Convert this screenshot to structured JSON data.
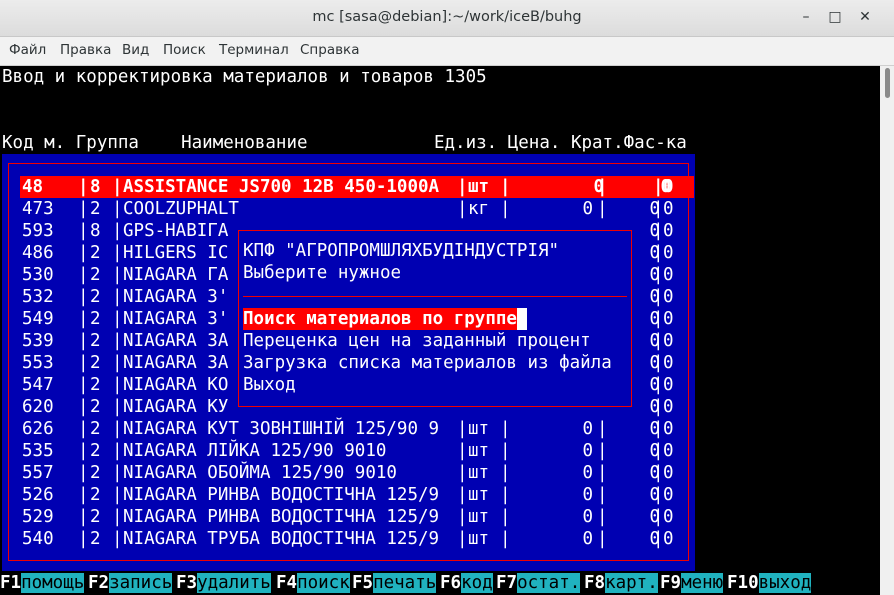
{
  "window": {
    "title": "mc [sasa@debian]:~/work/iceB/buhg",
    "min": "–",
    "max": "□",
    "close": "✕"
  },
  "menu": [
    "Файл",
    "Правка",
    "Вид",
    "Поиск",
    "Терминал",
    "Справка"
  ],
  "screen": {
    "heading": "Ввод и корректировка материалов и товаров 1305",
    "columns_header": "Код м. Группа    Наименование            Ед.из. Цена. Крат.Фас-ка"
  },
  "rows": [
    {
      "code": "48",
      "group": "8",
      "name": "ASSISTANCE JS700 12В 450-1000А",
      "unit": "шт",
      "price": "0",
      "krat": "0",
      "fas": "0",
      "selected": true
    },
    {
      "code": "473",
      "group": "2",
      "name": "COOLZUPHALT",
      "unit": "кг",
      "price": "0",
      "krat": "0",
      "fas": "0"
    },
    {
      "code": "593",
      "group": "8",
      "name": "GPS-НАВІГА",
      "unit": "",
      "price": "",
      "krat": "0",
      "fas": "0"
    },
    {
      "code": "486",
      "group": "2",
      "name": "HILGERS IC",
      "unit": "",
      "price": "",
      "krat": "0",
      "fas": "0"
    },
    {
      "code": "530",
      "group": "2",
      "name": "NIAGARA ГА",
      "unit": "",
      "price": "",
      "krat": "0",
      "fas": "0"
    },
    {
      "code": "532",
      "group": "2",
      "name": "NIAGARA З'",
      "unit": "",
      "price": "",
      "krat": "0",
      "fas": "0"
    },
    {
      "code": "549",
      "group": "2",
      "name": "NIAGARA З'",
      "unit": "",
      "price": "",
      "krat": "0",
      "fas": "0"
    },
    {
      "code": "539",
      "group": "2",
      "name": "NIAGARA ЗА",
      "unit": "",
      "price": "",
      "krat": "0",
      "fas": "0"
    },
    {
      "code": "553",
      "group": "2",
      "name": "NIAGARA ЗА",
      "unit": "",
      "price": "",
      "krat": "0",
      "fas": "0"
    },
    {
      "code": "547",
      "group": "2",
      "name": "NIAGARA КО",
      "unit": "",
      "price": "",
      "krat": "0",
      "fas": "0"
    },
    {
      "code": "620",
      "group": "2",
      "name": "NIAGARA КУ",
      "unit": "",
      "price": "",
      "krat": "0",
      "fas": "0"
    },
    {
      "code": "626",
      "group": "2",
      "name": "NIAGARA КУТ ЗОВНІШНІЙ 125/90 9",
      "unit": "шт",
      "price": "0",
      "krat": "0",
      "fas": "0"
    },
    {
      "code": "535",
      "group": "2",
      "name": "NIAGARA ЛІЙКА 125/90 9010",
      "unit": "шт",
      "price": "0",
      "krat": "0",
      "fas": "0"
    },
    {
      "code": "557",
      "group": "2",
      "name": "NIAGARA ОБОЙМА 125/90 9010",
      "unit": "шт",
      "price": "0",
      "krat": "0",
      "fas": "0"
    },
    {
      "code": "526",
      "group": "2",
      "name": "NIAGARA РИНВА ВОДОСТІЧНА 125/9",
      "unit": "шт",
      "price": "0",
      "krat": "0",
      "fas": "0"
    },
    {
      "code": "529",
      "group": "2",
      "name": "NIAGARA РИНВА ВОДОСТІЧНА 125/9",
      "unit": "шт",
      "price": "0",
      "krat": "0",
      "fas": "0"
    },
    {
      "code": "540",
      "group": "2",
      "name": "NIAGARA ТРУБА ВОДОСТІЧНА 125/9",
      "unit": "шт",
      "price": "0",
      "krat": "0",
      "fas": "0"
    }
  ],
  "dialog": {
    "company": "КПФ \"АГРОПРОМШЛЯХБУДІНДУСТРІЯ\"",
    "prompt": "Выберите нужное",
    "options": [
      "Поиск материалов по группе",
      "Переценка цен на заданный процент",
      "Загрузка списка материалов из файла",
      "Выход"
    ]
  },
  "fkeys": [
    {
      "key": "F1",
      "label": "помощь"
    },
    {
      "key": "F2",
      "label": "запись"
    },
    {
      "key": "F3",
      "label": "удалить"
    },
    {
      "key": "F4",
      "label": "поиск"
    },
    {
      "key": "F5",
      "label": "печать"
    },
    {
      "key": "F6",
      "label": "код"
    },
    {
      "key": "F7",
      "label": "остат."
    },
    {
      "key": "F8",
      "label": "карт."
    },
    {
      "key": "F9",
      "label": "меню"
    },
    {
      "key": "F10",
      "label": "выход"
    }
  ]
}
